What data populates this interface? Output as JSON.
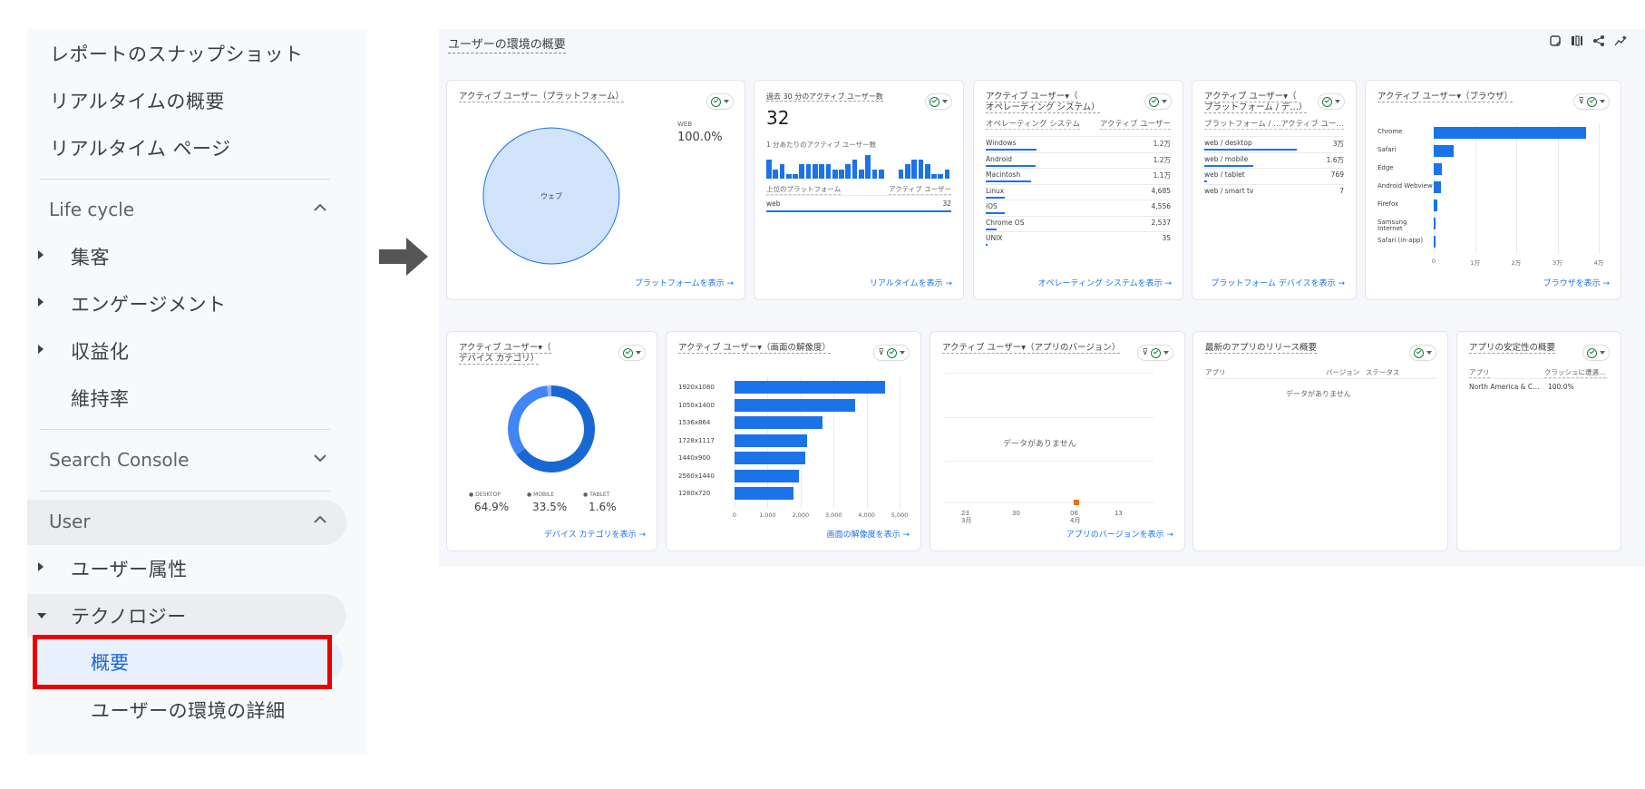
{
  "sidebar": {
    "links": [
      "レポートのスナップショット",
      "リアルタイムの概要",
      "リアルタイム ページ"
    ],
    "lifecycle": {
      "label": "Life cycle",
      "items": [
        "集客",
        "エンゲージメント",
        "収益化",
        "維持率"
      ]
    },
    "search_console": {
      "label": "Search Console"
    },
    "user": {
      "label": "User",
      "items": [
        "ユーザー属性",
        "テクノロジー"
      ],
      "subitems": [
        "概要",
        "ユーザーの環境の詳細"
      ]
    }
  },
  "dashboard": {
    "title": "ユーザーの環境の概要",
    "tool_icons": [
      "compare-icon",
      "columns-icon",
      "share-icon",
      "insights-icon"
    ]
  },
  "platform_card": {
    "title_prefix": "アクティブ ユーザー",
    "title_dim": "（プラットフォーム）",
    "legend_label": "WEB",
    "legend_value": "100.0%",
    "pie_label": "ウェブ",
    "footer": "プラットフォームを表示 →"
  },
  "realtime_card": {
    "title": "過去 30 分のアクティブ ユーザー数",
    "value": "32",
    "subtitle": "1 分あたりのアクティブ ユーザー数",
    "col1": "上位のプラットフォーム",
    "col2": "アクティブ ユーザー",
    "row_label": "web",
    "row_value": "32",
    "footer": "リアルタイムを表示 →",
    "bars": [
      4,
      2,
      3,
      1,
      1,
      3,
      3,
      3,
      3,
      3,
      2,
      2,
      3,
      4,
      2,
      5,
      2,
      2,
      0,
      0,
      2,
      3,
      4,
      4,
      3,
      1,
      1,
      2
    ]
  },
  "os_card": {
    "title1": "アクティブ ユーザー▾（",
    "title2": "オペレーティング システム）",
    "col1": "オペレーティング システム",
    "col2": "アクティブ ユーザー",
    "rows": [
      {
        "label": "Windows",
        "value": "1.2万",
        "frac": 1.0
      },
      {
        "label": "Android",
        "value": "1.2万",
        "frac": 0.98
      },
      {
        "label": "Macintosh",
        "value": "1.1万",
        "frac": 0.9
      },
      {
        "label": "Linux",
        "value": "4,685",
        "frac": 0.38
      },
      {
        "label": "iOS",
        "value": "4,556",
        "frac": 0.37
      },
      {
        "label": "Chrome OS",
        "value": "2,537",
        "frac": 0.21
      },
      {
        "label": "UNIX",
        "value": "35",
        "frac": 0.01
      }
    ],
    "footer": "オペレーティング システムを表示 →"
  },
  "device_platform_card": {
    "title1": "アクティブ ユーザー▾（",
    "title2": "プラットフォーム / デ…）",
    "col1": "プラットフォーム / …",
    "col2": "アクティブ ユー…",
    "rows": [
      {
        "label": "web / desktop",
        "value": "3万",
        "frac": 1.0
      },
      {
        "label": "web / mobile",
        "value": "1.6万",
        "frac": 0.53
      },
      {
        "label": "web / tablet",
        "value": "769",
        "frac": 0.03
      },
      {
        "label": "web / smart tv",
        "value": "7",
        "frac": 0
      }
    ],
    "footer": "プラットフォーム デバイスを表示 →"
  },
  "browser_card": {
    "title": "アクティブ ユーザー▾（ブラウザ）",
    "footer": "ブラウザを表示 →",
    "chart_data": {
      "type": "bar",
      "orientation": "horizontal",
      "categories": [
        "Chrome",
        "Safari",
        "Edge",
        "Android Webview",
        "Firefox",
        "Samsung Internet",
        "Safari (in-app)"
      ],
      "values": [
        37000,
        4800,
        2000,
        1800,
        800,
        300,
        200
      ],
      "xticks": [
        "0",
        "1万",
        "2万",
        "3万",
        "4万"
      ],
      "xlim": [
        0,
        40000
      ]
    }
  },
  "device_card": {
    "title1": "アクティブ ユーザー▾（",
    "title2": "デバイス カテゴリ）",
    "footer": "デバイス カテゴリを表示 →",
    "chart_data": {
      "type": "pie",
      "donut": true,
      "categories": [
        "DESKTOP",
        "MOBILE",
        "TABLET"
      ],
      "values": [
        64.9,
        33.5,
        1.6
      ],
      "labels": [
        "64.9%",
        "33.5%",
        "1.6%"
      ],
      "colors": [
        "#1967d2",
        "#4285f4",
        "#8ab4f8"
      ]
    }
  },
  "resolution_card": {
    "title": "アクティブ ユーザー▾（画面の解像度）",
    "footer": "画面の解像度を表示 →",
    "chart_data": {
      "type": "bar",
      "orientation": "horizontal",
      "categories": [
        "1920x1080",
        "1050x1400",
        "1536x864",
        "1728x1117",
        "1440x900",
        "2560x1440",
        "1280x720"
      ],
      "values": [
        4550,
        3650,
        2650,
        2200,
        2150,
        1950,
        1780
      ],
      "xticks": [
        "0",
        "1,000",
        "2,000",
        "3,000",
        "4,000",
        "5,000"
      ],
      "xlim": [
        0,
        5000
      ]
    }
  },
  "appversion_card": {
    "title": "アクティブ ユーザー▾（アプリのバージョン）",
    "empty": "データがありません",
    "xticks": [
      "23\n3月",
      "30",
      "06\n4月",
      "13"
    ],
    "footer": "アプリのバージョンを表示 →"
  },
  "release_card": {
    "title": "最新のアプリのリリース概要",
    "col1": "アプリ",
    "col2": "バージョン",
    "col3": "ステータス",
    "empty": "データがありません"
  },
  "stability_card": {
    "title": "アプリの安定性の概要",
    "col1": "アプリ",
    "col2": "クラッシュに遭遇…",
    "row_label": "North America & C…",
    "row_value": "100.0%"
  },
  "colors": {
    "accent": "#1a73e8",
    "highlight_box": "#ea0000",
    "pie_fill": "#d2e3fc"
  }
}
